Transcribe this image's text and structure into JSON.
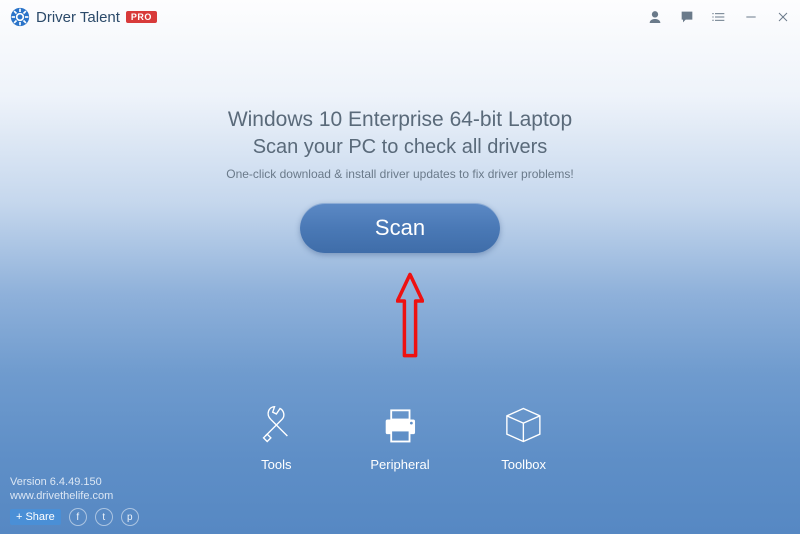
{
  "app": {
    "name": "Driver Talent",
    "badge": "PRO"
  },
  "titlebar": {
    "icons": {
      "user": "user-icon",
      "feedback": "chat-icon",
      "menu": "list-icon",
      "min": "minimize-icon",
      "close": "close-icon"
    }
  },
  "main": {
    "system_line": "Windows 10 Enterprise 64-bit Laptop",
    "prompt_line": "Scan your PC to check all drivers",
    "hint_line": "One-click download & install driver updates to fix driver problems!",
    "scan_label": "Scan"
  },
  "nav": {
    "tools": "Tools",
    "peripheral": "Peripheral",
    "toolbox": "Toolbox"
  },
  "footer": {
    "version": "Version 6.4.49.150",
    "url": "www.drivethelife.com",
    "share_label": "Share",
    "social": {
      "fb": "f",
      "tw": "t",
      "pi": "p"
    }
  }
}
